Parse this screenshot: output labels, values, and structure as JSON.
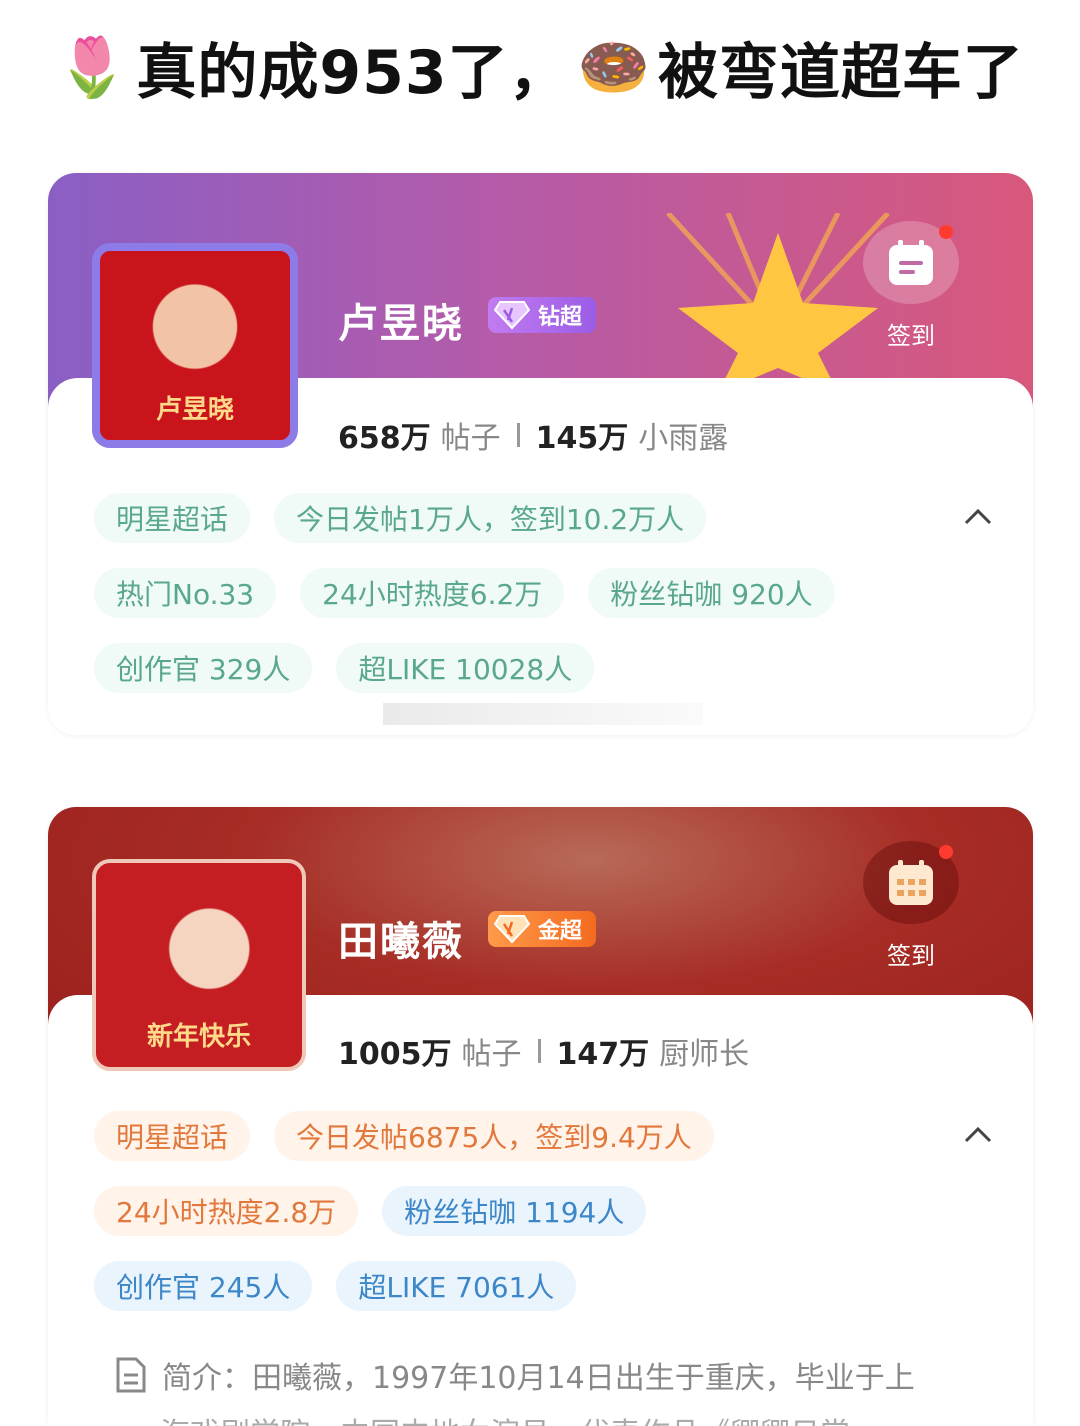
{
  "headline": {
    "emoji_left": "🌷",
    "text_part1": "真的成953了，",
    "emoji_right": "🍩",
    "text_part2": "被弯道超车了"
  },
  "cards": [
    {
      "name": "卢昱晓",
      "level_badge": "钻超",
      "avatar_caption": "卢昱晓",
      "checkin_label": "签到",
      "posts_num": "658万",
      "posts_label": "帖子",
      "fans_num": "145万",
      "fans_label": "小雨露",
      "chips": [
        [
          "明星超话",
          "今日发帖1万人，签到10.2万人"
        ],
        [
          "热门No.33",
          "24小时热度6.2万",
          "粉丝钻咖 920人"
        ],
        [
          "创作官 329人",
          "超LIKE 10028人"
        ]
      ]
    },
    {
      "name": "田曦薇",
      "level_badge": "金超",
      "avatar_caption": "新年快乐",
      "checkin_label": "签到",
      "posts_num": "1005万",
      "posts_label": "帖子",
      "fans_num": "147万",
      "fans_label": "厨师长",
      "chips": [
        [
          "明星超话",
          "今日发帖6875人，签到9.4万人"
        ],
        [
          "24小时热度2.8万",
          "粉丝钻咖 1194人"
        ],
        [
          "创作官 245人",
          "超LIKE 7061人"
        ]
      ],
      "intro_line1": "简介：田曦薇，1997年10月14日出生于重庆，毕业于上",
      "intro_line2": "海戏剧学院，中国内地女演员，代表作品《卿卿日常"
    }
  ],
  "colors": {
    "card1_banner": "#b45ba9",
    "card2_banner": "#a62c25",
    "chip_green": "#5aa88c",
    "chip_orange": "#e2783b",
    "chip_blue": "#3d87c9"
  },
  "icons": [
    "tulip-emoji",
    "donut-emoji",
    "diamond-gem-icon",
    "gold-gem-icon",
    "calendar-icon",
    "chevron-up-icon",
    "document-icon"
  ]
}
